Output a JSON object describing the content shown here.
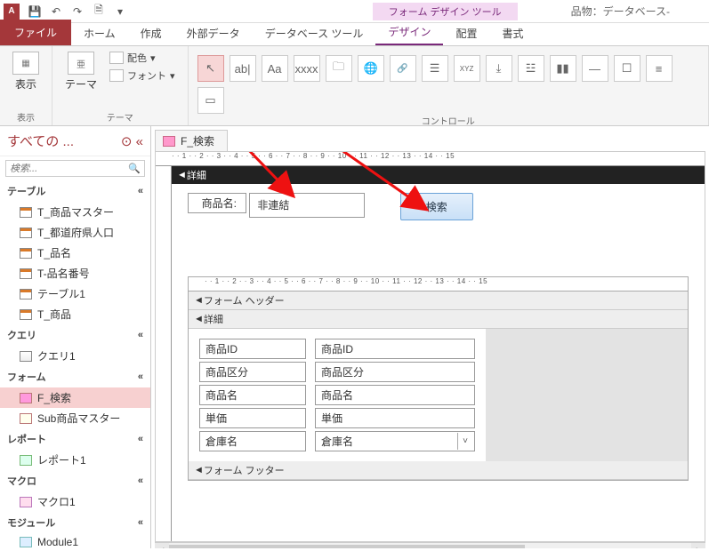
{
  "titlebar": {
    "app_icon": "A",
    "context_tab": "フォーム デザイン ツール",
    "doc_title": "品物：データベース-"
  },
  "ribbon_tabs": {
    "file": "ファイル",
    "home": "ホーム",
    "create": "作成",
    "external": "外部データ",
    "dbtools": "データベース ツール",
    "design": "デザイン",
    "arrange": "配置",
    "format": "書式"
  },
  "ribbon": {
    "view": "表示",
    "theme": "テーマ",
    "colors": "配色",
    "fonts": "フォント",
    "group_theme": "テーマ",
    "controls_label": "コントロール",
    "ctrl_textbox": "ab|",
    "ctrl_label": "Aa",
    "ctrl_btn": "xxxx",
    "ctrl_xyz": "XYZ"
  },
  "nav": {
    "header": "すべての  ...",
    "search_placeholder": "検索...",
    "sec_tables": "テーブル",
    "sec_queries": "クエリ",
    "sec_forms": "フォーム",
    "sec_reports": "レポート",
    "sec_macros": "マクロ",
    "sec_modules": "モジュール",
    "tables": [
      "T_商品マスター",
      "T_都道府県人口",
      "T_品名",
      "T-品名番号",
      "テーブル1",
      "T_商品"
    ],
    "queries": [
      "クエリ1"
    ],
    "forms": [
      "F_検索",
      "Sub商品マスター"
    ],
    "reports": [
      "レポート1"
    ],
    "macros": [
      "マクロ1"
    ],
    "modules": [
      "Module1"
    ]
  },
  "form_tab": "F_検索",
  "outer_form": {
    "detail_bar": "詳細",
    "label_product_name": "商品名:",
    "textbox_unbound": "非連結",
    "button_search": "検索"
  },
  "subform": {
    "header_bar": "フォーム ヘッダー",
    "detail_bar": "詳細",
    "footer_bar": "フォーム フッター",
    "fields": [
      {
        "label": "商品ID",
        "value": "商品ID"
      },
      {
        "label": "商品区分",
        "value": "商品区分"
      },
      {
        "label": "商品名",
        "value": "商品名"
      },
      {
        "label": "単価",
        "value": "単価"
      },
      {
        "label": "倉庫名",
        "value": "倉庫名",
        "combo": true
      }
    ]
  },
  "ruler_text": "· · 1 · · 2 · · 3 · · 4 · · 5 · · 6 · · 7 · · 8 · · 9 · · 10 · · 11 · · 12 · · 13 · · 14 · · 15"
}
